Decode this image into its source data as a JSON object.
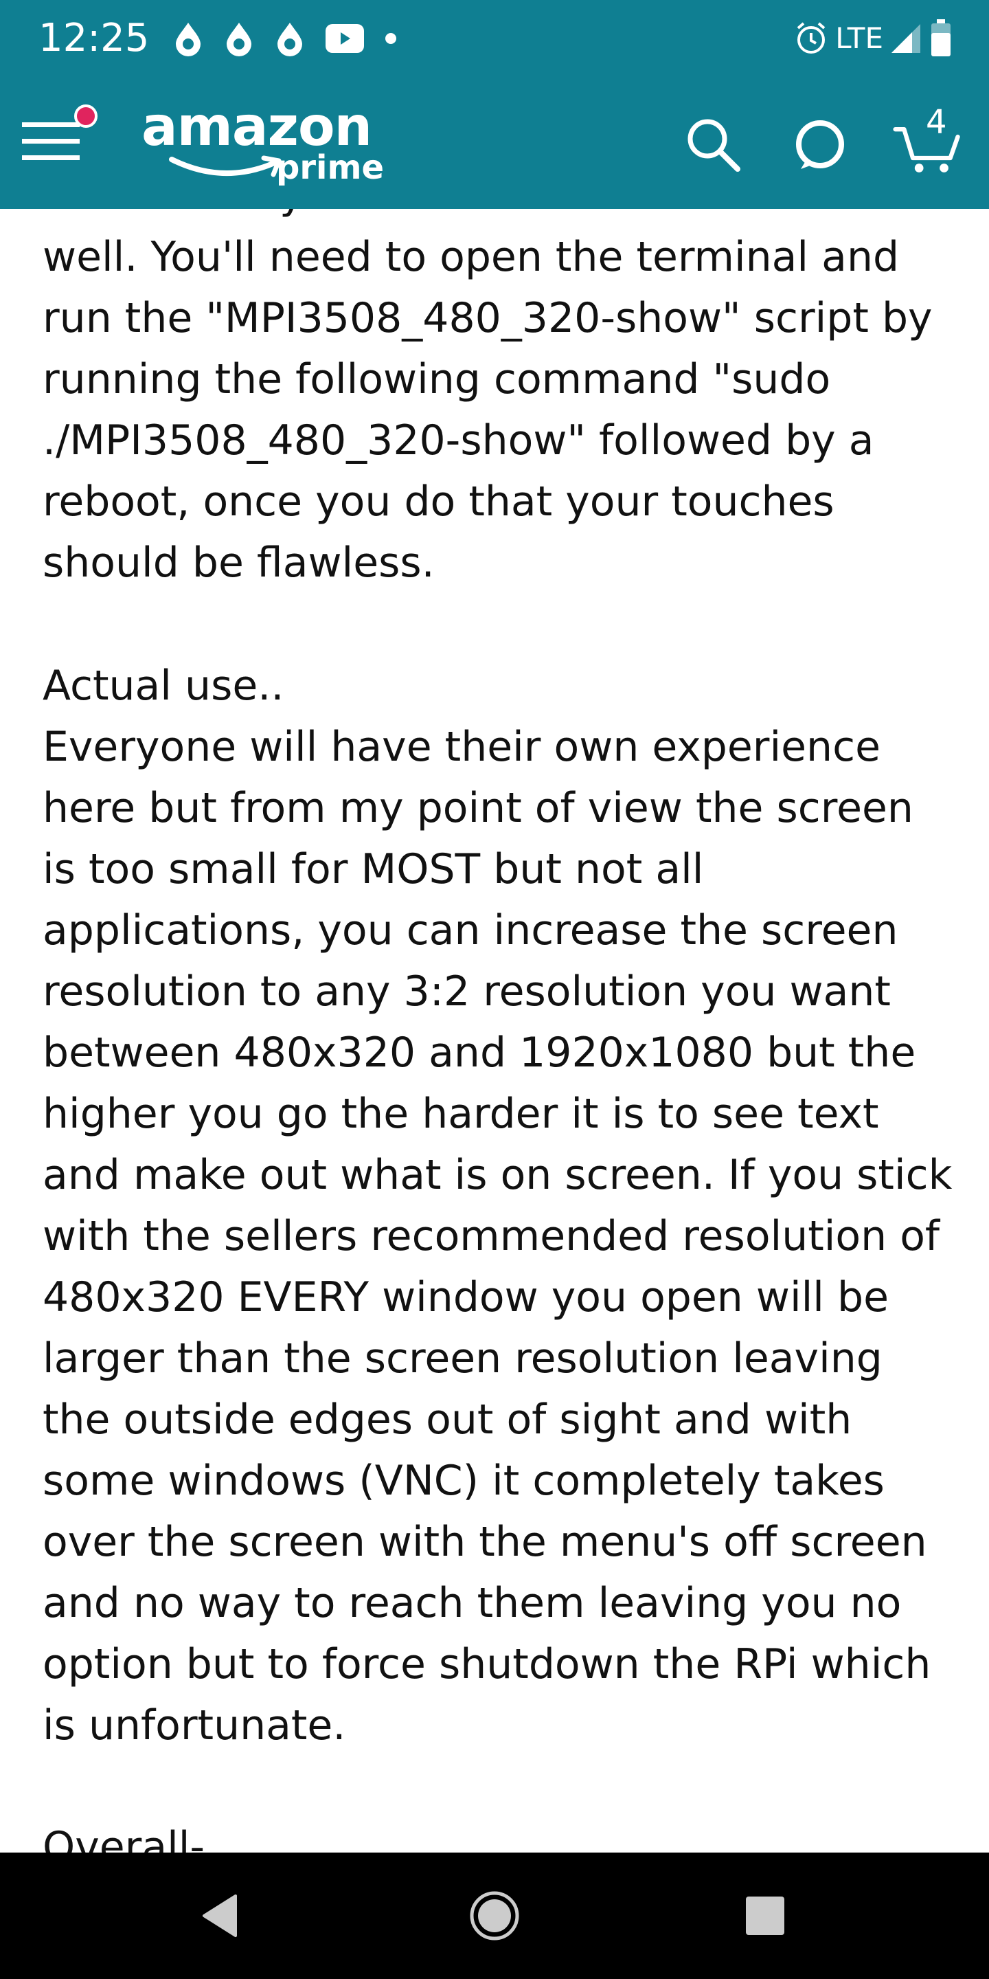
{
  "status_bar": {
    "time": "12:25",
    "notification_icons": [
      "water-drop-icon",
      "water-drop-icon",
      "water-drop-icon",
      "youtube-icon",
      "dot-icon"
    ],
    "alarm_icon": "alarm-clock-icon",
    "network_label": "LTE",
    "signal_icon": "signal-icon",
    "battery_icon": "battery-icon"
  },
  "header": {
    "logo_text": "amazon",
    "logo_subtext": "prime",
    "menu_icon": "menu-icon",
    "search_icon": "search-icon",
    "alexa_icon": "alexa-icon",
    "cart_icon": "cart-icon",
    "cart_count": "4",
    "background_color": "#0f7f92",
    "badge_color": "#e0245e"
  },
  "review": {
    "cutoff_top_line": "notice that your touches are not calibrated",
    "calibration_paragraph": "well. You'll need to open the terminal and\nrun the \"MPI3508_480_320-show\" script by\nrunning the following command \"sudo\n./MPI3508_480_320-show\" followed by a\nreboot, once you do that your touches\nshould be flawless.",
    "actual_use_heading": "Actual use..",
    "actual_use_paragraph": "Everyone will have their own experience\nhere but from my point of view the screen\nis too small for MOST but not all\napplications, you can increase the screen\nresolution to any 3:2 resolution you want\nbetween 480x320 and 1920x1080 but the\nhigher you go the harder it is to see text\nand make out what is on screen. If you stick\nwith the sellers recommended resolution of\n480x320 EVERY window you open will be\nlarger than the screen resolution leaving\nthe outside edges out of sight and with\nsome windows (VNC) it completely takes\nover the screen with the menu's off screen\nand no way to reach them leaving you no\noption but to force shutdown the RPi which\nis unfortunate.",
    "overall_heading": "Overall-"
  },
  "nav_bar": {
    "back_icon": "back-triangle-icon",
    "home_icon": "home-circle-icon",
    "recents_icon": "recents-square-icon"
  }
}
